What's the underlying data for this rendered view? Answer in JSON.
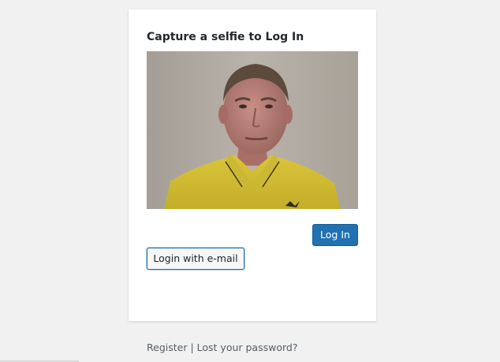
{
  "login_card": {
    "title": "Capture a selfie to Log In",
    "camera_alt": "Webcam selfie preview",
    "login_button": "Log In",
    "email_button": "Login with e-mail"
  },
  "nav": {
    "register": "Register",
    "separator": " | ",
    "lost_password": "Lost your password?"
  },
  "colors": {
    "primary": "#2271b1",
    "background": "#f1f1f1"
  }
}
